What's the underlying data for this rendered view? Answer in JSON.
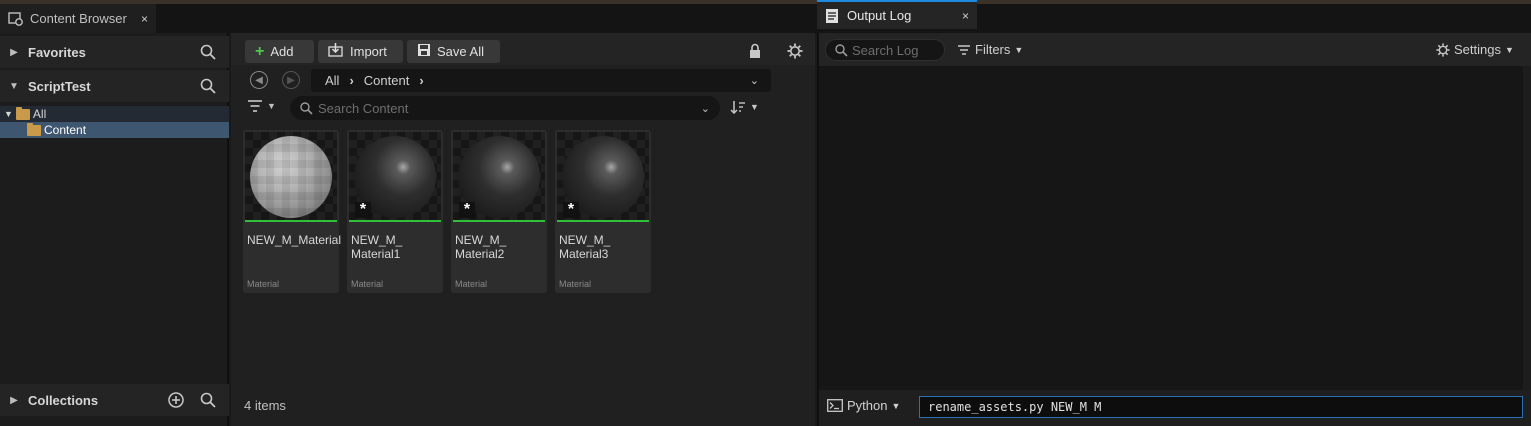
{
  "content_browser": {
    "tab_label": "Content Browser",
    "close_glyph": "×",
    "sidebar": {
      "favorites_label": "Favorites",
      "project_label": "ScriptTest",
      "collections_label": "Collections",
      "tree": [
        {
          "label": "All"
        },
        {
          "label": "Content"
        }
      ]
    },
    "toolbar": {
      "add_label": "Add",
      "import_label": "Import",
      "save_all_label": "Save All"
    },
    "path": {
      "segments": [
        "All",
        "Content"
      ]
    },
    "search": {
      "placeholder": "Search Content"
    },
    "assets": [
      {
        "name": "NEW_M_Material",
        "type": "Material",
        "style": "grey",
        "modified": false
      },
      {
        "name": "NEW_M_\nMaterial1",
        "type": "Material",
        "style": "dark",
        "modified": true
      },
      {
        "name": "NEW_M_\nMaterial2",
        "type": "Material",
        "style": "dark",
        "modified": true
      },
      {
        "name": "NEW_M_\nMaterial3",
        "type": "Material",
        "style": "dark",
        "modified": true
      }
    ],
    "item_count": "4 items",
    "accent_colors": {
      "selection": "#3e5670",
      "asset_underline": "#2fbf3a",
      "folder": "#c99a4a"
    }
  },
  "output_log": {
    "tab_label": "Output Log",
    "close_glyph": "×",
    "search_placeholder": "Search Log",
    "filters_label": "Filters",
    "settings_label": "Settings",
    "interpreter": "Python",
    "command_value": "rename_assets.py NEW_M M",
    "accent_colors": {
      "active_tab": "#1e8be0",
      "command_border": "#2a6fb8"
    }
  }
}
